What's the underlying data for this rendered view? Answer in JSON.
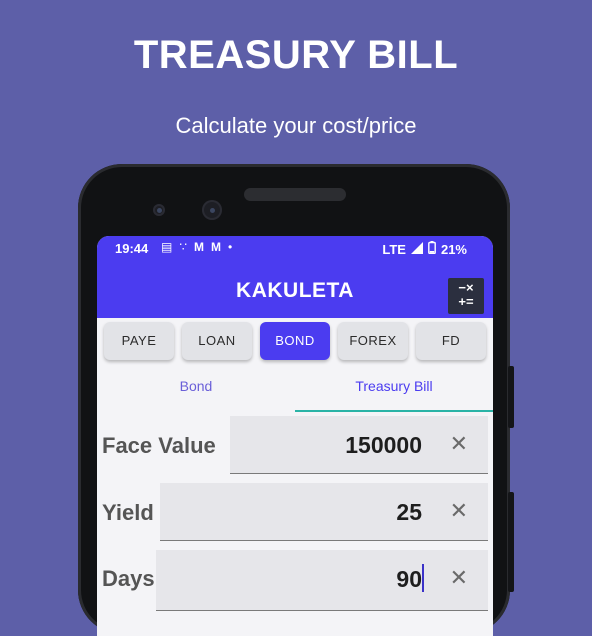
{
  "promo": {
    "headline": "TREASURY BILL",
    "subline": "Calculate your cost/price"
  },
  "status_bar": {
    "time": "19:44",
    "notification_icons": [
      "message-icon",
      "hotspot-icon",
      "gmail-icon",
      "gmail-icon",
      "dot-icon"
    ],
    "network": "LTE",
    "battery": "21%"
  },
  "app": {
    "title": "KAKULETA",
    "accent": "#4b3cf0",
    "calc_icon": "calculator-icon"
  },
  "tabs": [
    {
      "label": "PAYE",
      "active": false
    },
    {
      "label": "LOAN",
      "active": false
    },
    {
      "label": "BOND",
      "active": true
    },
    {
      "label": "FOREX",
      "active": false
    },
    {
      "label": "FD",
      "active": false
    }
  ],
  "subtabs": [
    {
      "label": "Bond",
      "active": false
    },
    {
      "label": "Treasury Bill",
      "active": true
    }
  ],
  "fields": [
    {
      "label": "Face Value",
      "value": "150000"
    },
    {
      "label": "Yield",
      "value": "25"
    },
    {
      "label": "Days",
      "value": "90"
    }
  ]
}
